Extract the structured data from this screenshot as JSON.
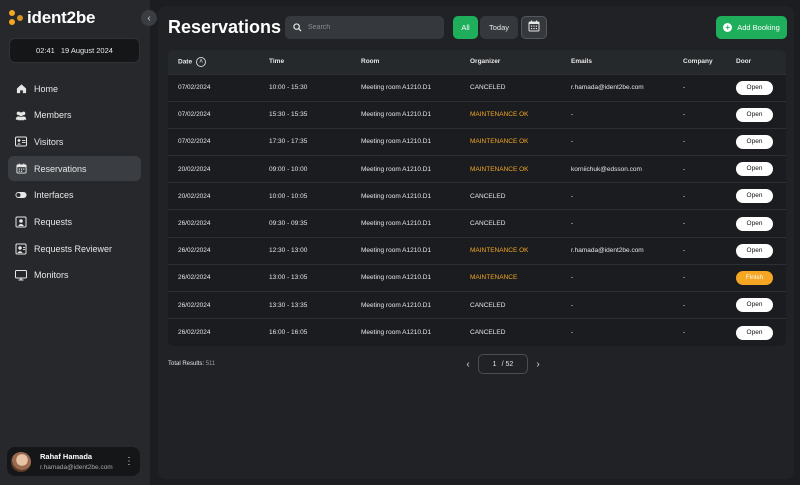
{
  "brand": {
    "name": "ident2be"
  },
  "clock": {
    "time": "02:41",
    "date": "19 August 2024"
  },
  "sidebar": {
    "items": [
      {
        "label": "Home",
        "icon": "home-icon"
      },
      {
        "label": "Members",
        "icon": "members-icon"
      },
      {
        "label": "Visitors",
        "icon": "visitors-icon"
      },
      {
        "label": "Reservations",
        "icon": "calendar-icon",
        "active": true
      },
      {
        "label": "Interfaces",
        "icon": "toggle-icon"
      },
      {
        "label": "Requests",
        "icon": "requests-icon"
      },
      {
        "label": "Requests Reviewer",
        "icon": "reviewer-icon"
      },
      {
        "label": "Monitors",
        "icon": "monitor-icon"
      }
    ]
  },
  "user": {
    "name": "Rahaf Hamada",
    "email": "r.hamada@ident2be.com"
  },
  "header": {
    "title": "Reservations",
    "search_placeholder": "Search",
    "filter_all": "All",
    "filter_today": "Today",
    "add_booking": "Add Booking"
  },
  "table": {
    "columns": [
      "Date",
      "Time",
      "Room",
      "Organizer",
      "Emails",
      "Company",
      "Door"
    ],
    "rows": [
      {
        "date": "07/02/2024",
        "time": "10:00 - 15:30",
        "room": "Meeting room A1210.D1",
        "organizer": "CANCELED",
        "email": "r.hamada@ident2be.com",
        "company": "-",
        "door": "Open"
      },
      {
        "date": "07/02/2024",
        "time": "15:30 - 15:35",
        "room": "Meeting room A1210.D1",
        "organizer": "MAINTENANCE OK",
        "email": "-",
        "company": "-",
        "door": "Open"
      },
      {
        "date": "07/02/2024",
        "time": "17:30 - 17:35",
        "room": "Meeting room A1210.D1",
        "organizer": "MAINTENANCE OK",
        "email": "-",
        "company": "-",
        "door": "Open"
      },
      {
        "date": "20/02/2024",
        "time": "09:00 - 10:00",
        "room": "Meeting room A1210.D1",
        "organizer": "MAINTENANCE OK",
        "email": "korniichuk@edsson.com",
        "company": "-",
        "door": "Open"
      },
      {
        "date": "20/02/2024",
        "time": "10:00 - 10:05",
        "room": "Meeting room A1210.D1",
        "organizer": "CANCELED",
        "email": "-",
        "company": "-",
        "door": "Open"
      },
      {
        "date": "26/02/2024",
        "time": "09:30 - 09:35",
        "room": "Meeting room A1210.D1",
        "organizer": "CANCELED",
        "email": "-",
        "company": "-",
        "door": "Open"
      },
      {
        "date": "26/02/2024",
        "time": "12:30 - 13:00",
        "room": "Meeting room A1210.D1",
        "organizer": "MAINTENANCE OK",
        "email": "r.hamada@ident2be.com",
        "company": "-",
        "door": "Open"
      },
      {
        "date": "26/02/2024",
        "time": "13:00 - 13:05",
        "room": "Meeting room A1210.D1",
        "organizer": "MAINTENANCE",
        "email": "-",
        "company": "-",
        "door": "Finish"
      },
      {
        "date": "26/02/2024",
        "time": "13:30 - 13:35",
        "room": "Meeting room A1210.D1",
        "organizer": "CANCELED",
        "email": "-",
        "company": "-",
        "door": "Open"
      },
      {
        "date": "26/02/2024",
        "time": "16:00 - 16:05",
        "room": "Meeting room A1210.D1",
        "organizer": "CANCELED",
        "email": "-",
        "company": "-",
        "door": "Open"
      }
    ]
  },
  "footer": {
    "total_label": "Total Results:",
    "total_value": "511",
    "current_page": "1",
    "separator": "/",
    "total_pages": "52"
  },
  "colors": {
    "accent_green": "#1fae5b",
    "warning_orange": "#f5a623",
    "panel": "#202225",
    "sidebar": "#26282b"
  }
}
